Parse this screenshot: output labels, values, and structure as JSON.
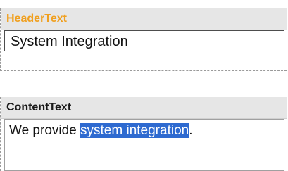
{
  "header_block": {
    "label": "HeaderText",
    "value": "System Integration"
  },
  "content_block": {
    "label": "ContentText",
    "value_before": "We provide ",
    "value_selected": "system integration",
    "value_after": "."
  },
  "colors": {
    "header_label": "#f0a020",
    "selection": "#2e6ad0"
  }
}
